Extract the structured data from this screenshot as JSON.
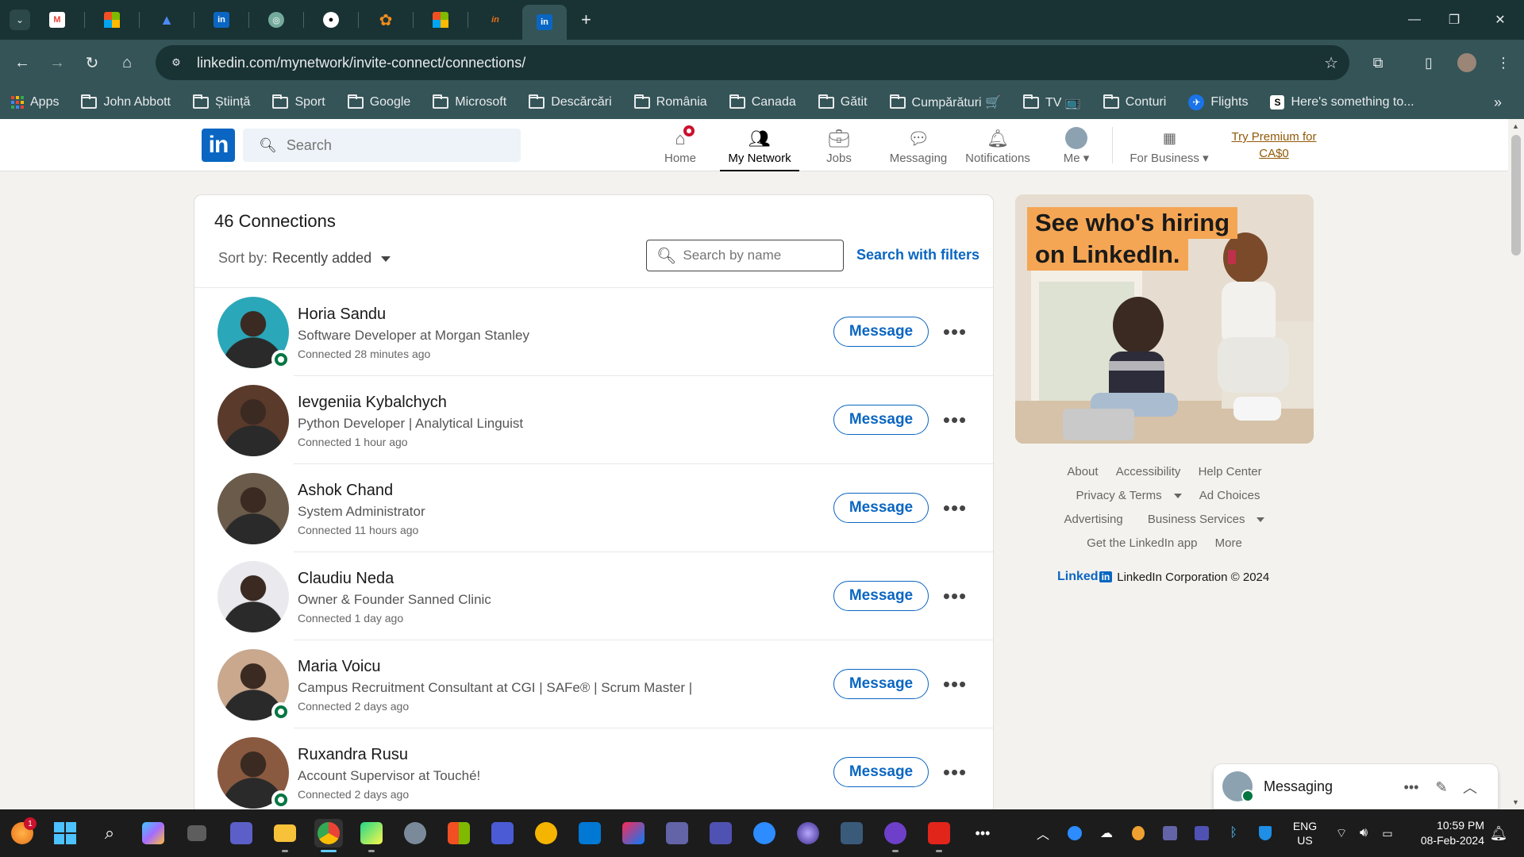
{
  "browser": {
    "tabs": [
      {
        "icon": "gmail-icon",
        "color": "#ea4335",
        "glyph": "M"
      },
      {
        "icon": "microsoft-icon",
        "color": "#f25022",
        "glyph": ""
      },
      {
        "icon": "drive-triangle-icon",
        "color": "#4c8bf5",
        "glyph": "▲"
      },
      {
        "icon": "linkedin-icon",
        "color": "#0a66c2",
        "glyph": "in"
      },
      {
        "icon": "chatgpt-icon",
        "color": "#74aa9c",
        "glyph": "◎"
      },
      {
        "icon": "github-icon",
        "color": "#ffffff",
        "glyph": "●"
      },
      {
        "icon": "flower-icon",
        "color": "#f08c1e",
        "glyph": "✿"
      },
      {
        "icon": "microsoft-icon",
        "color": "#f25022",
        "glyph": ""
      },
      {
        "icon": "indeed-icon",
        "color": "#e8711a",
        "glyph": "in"
      },
      {
        "icon": "linkedin-icon",
        "color": "#0a66c2",
        "glyph": "in"
      }
    ],
    "new_tab": "+",
    "url": "linkedin.com/mynetwork/invite-connect/connections/",
    "bookmarks": [
      "Apps",
      "John Abbott",
      "Știință",
      "Sport",
      "Google",
      "Microsoft",
      "Descărcări",
      "România",
      "Canada",
      "Gătit",
      "Cumpărături 🛒",
      "TV 📺",
      "Conturi",
      "Flights",
      "Here's something to..."
    ]
  },
  "linkedin": {
    "search_placeholder": "Search",
    "nav": [
      {
        "label": "Home",
        "icon": "home-icon"
      },
      {
        "label": "My Network",
        "icon": "network-icon"
      },
      {
        "label": "Jobs",
        "icon": "briefcase-icon"
      },
      {
        "label": "Messaging",
        "icon": "chat-icon"
      },
      {
        "label": "Notifications",
        "icon": "bell-icon"
      },
      {
        "label": "Me",
        "icon": "avatar"
      },
      {
        "label": "For Business",
        "icon": "grid-icon"
      }
    ],
    "premium_line1": "Try Premium for",
    "premium_line2": "CA$0"
  },
  "connections": {
    "title": "46 Connections",
    "sort_label": "Sort by:",
    "sort_value": "Recently added",
    "search_placeholder": "Search by name",
    "search_filters": "Search with filters",
    "message_label": "Message",
    "more_label": "•••",
    "items": [
      {
        "name": "Horia Sandu",
        "headline": "Software Developer at Morgan Stanley",
        "connected": "Connected 28 minutes ago",
        "online": true,
        "avatar": "#2aa7b8"
      },
      {
        "name": "Ievgeniia Kybalchych",
        "headline": "Python Developer | Analytical Linguist",
        "connected": "Connected 1 hour ago",
        "online": false,
        "avatar": "#5a3a2a"
      },
      {
        "name": "Ashok Chand",
        "headline": "System Administrator",
        "connected": "Connected 11 hours ago",
        "online": false,
        "avatar": "#6b5b4a"
      },
      {
        "name": "Claudiu Neda",
        "headline": "Owner & Founder Sanned Clinic",
        "connected": "Connected 1 day ago",
        "online": false,
        "avatar": "#e9e9ee"
      },
      {
        "name": "Maria Voicu",
        "headline": "Campus Recruitment Consultant at CGI | SAFe® | Scrum Master |",
        "connected": "Connected 2 days ago",
        "online": true,
        "avatar": "#c9a88e"
      },
      {
        "name": "Ruxandra Rusu",
        "headline": "Account Supervisor at Touché!",
        "connected": "Connected 2 days ago",
        "online": true,
        "avatar": "#8a5a40"
      }
    ]
  },
  "ad": {
    "line1": "See who's hiring",
    "line2": "on LinkedIn."
  },
  "footer": {
    "row1": [
      "About",
      "Accessibility",
      "Help Center"
    ],
    "row2": [
      "Privacy & Terms",
      "Ad Choices"
    ],
    "row3": [
      "Advertising",
      "Business Services"
    ],
    "row4": [
      "Get the LinkedIn app",
      "More"
    ],
    "brand": "Linked",
    "brand_in": "in",
    "copyright": "LinkedIn Corporation © 2024"
  },
  "messaging": {
    "label": "Messaging"
  },
  "taskbar": {
    "lang1": "ENG",
    "lang2": "US",
    "time": "10:59 PM",
    "date": "08-Feb-2024",
    "notif_count": "1"
  },
  "colors": {
    "linkedin_blue": "#0a66c2",
    "online_green": "#057642",
    "premium_gold": "#915907"
  }
}
